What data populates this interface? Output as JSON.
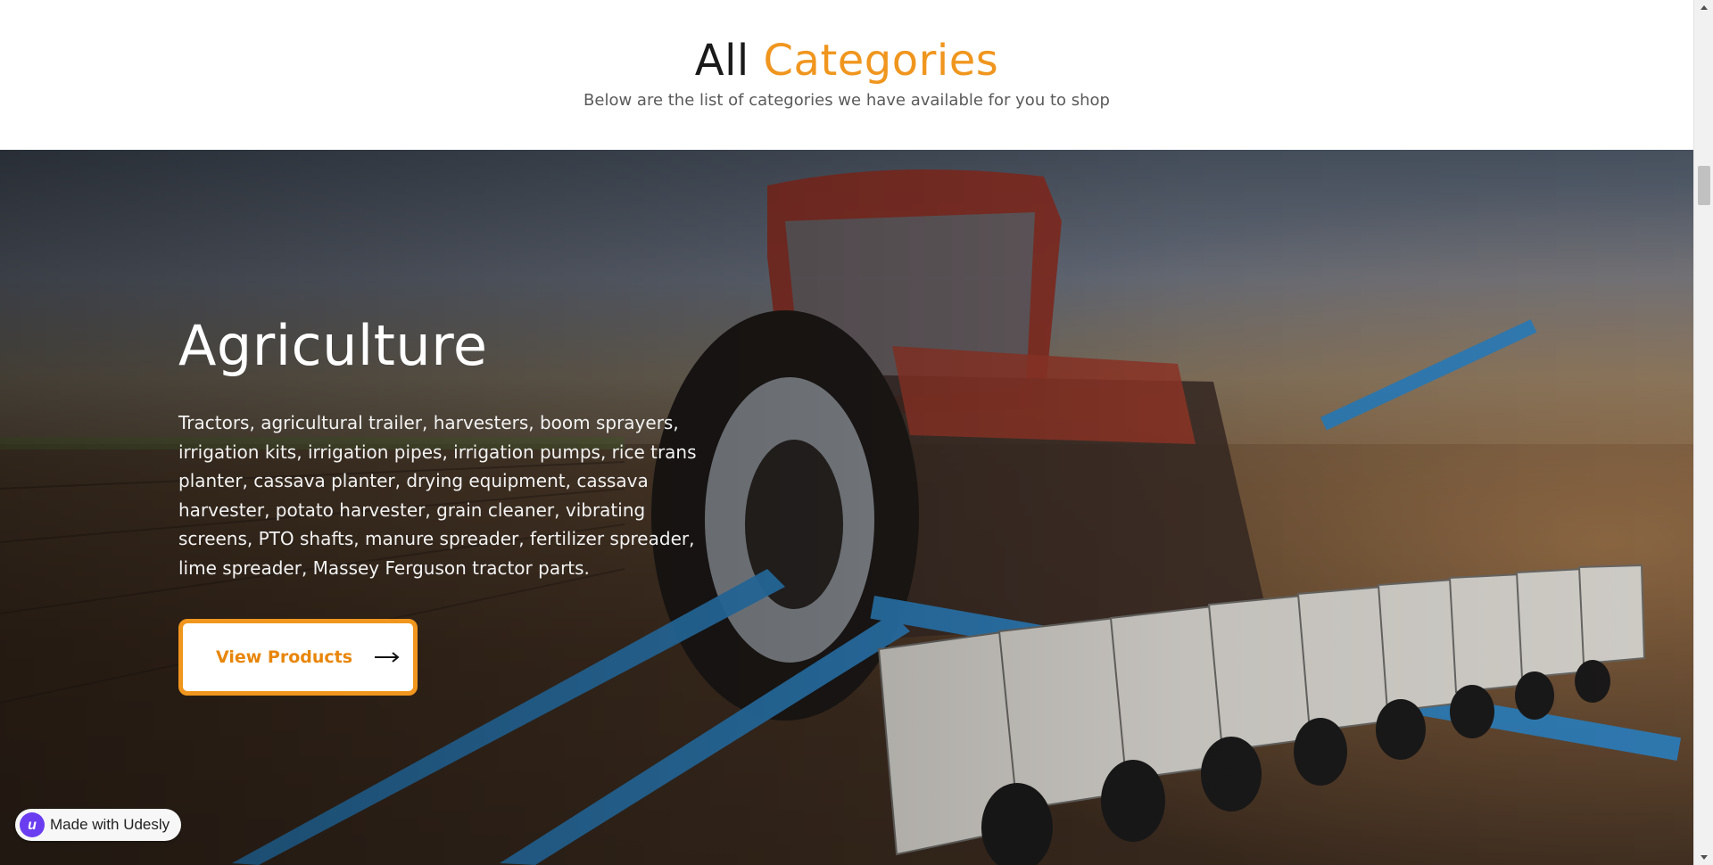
{
  "header": {
    "title_main": "All",
    "title_accent": "Categories",
    "subtitle": "Below are the list of categories we have available for you to shop"
  },
  "hero": {
    "title": "Agriculture",
    "description": "Tractors, agricultural trailer, harvesters, boom sprayers, irrigation kits, irrigation pipes, irrigation pumps, rice trans planter, cassava planter, drying equipment, cassava harvester, potato harvester, grain cleaner, vibrating screens, PTO shafts, manure spreader, fertilizer spreader, lime spreader, Massey Ferguson tractor parts.",
    "button_label": "View Products",
    "button_icon": "arrow-right-icon",
    "background_image": "tractor-with-planter-in-field"
  },
  "badge": {
    "label": "Made with Udesly",
    "logo_letter": "u"
  },
  "colors": {
    "accent": "#f0961e",
    "badge_logo": "#6a3df0"
  }
}
